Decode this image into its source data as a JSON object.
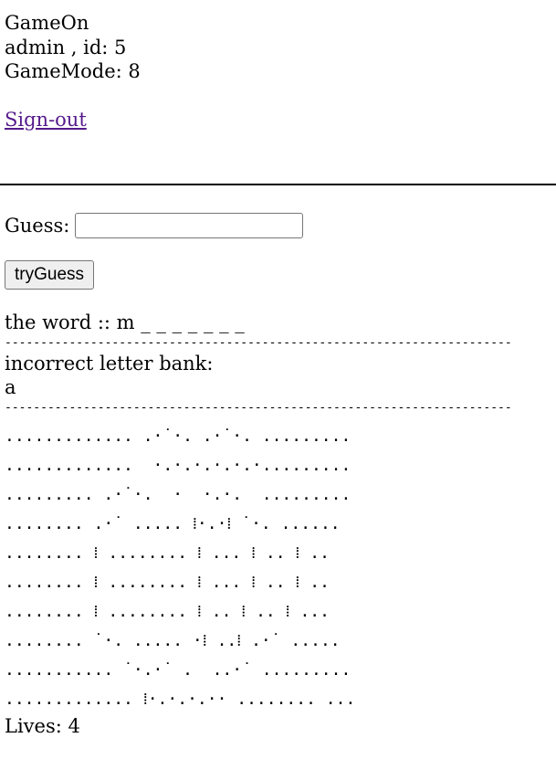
{
  "header": {
    "app_title": "GameOn",
    "user_line": "admin , id: 5",
    "game_mode": "GameMode: 8",
    "signout_link": "Sign-out"
  },
  "guess": {
    "label": "Guess:",
    "value": "",
    "placeholder": ""
  },
  "button": {
    "try_label": "tryGuess"
  },
  "word": {
    "text": "the word :: m _ _ _ _ _ _ _"
  },
  "separator": "-----------------------------------------------------------------------",
  "bank": {
    "label": "incorrect letter bank:",
    "letters": "a"
  },
  "art_lines": [
    "............. .·˙·. .·˙·. .........",
    ".............  ·.·.·.·.·.·.........",
    "......... .·˙·.  ·  ·.·.  .........",
    "........ .·˙ ..... ⁞·.·⁞ ˙·. ......",
    "........ ⁞ ........ ⁞ ... ⁞ .. ⁞ ..",
    "........ ⁞ ........ ⁞ ... ⁞ .. ⁞ ..",
    "........ ⁞ ........ ⁞ .. ⁞ .. ⁞ ...",
    "........ ˙·. ..... ·⁞ ..⁞ .·˙ .....",
    "........... ˙·.·˙ .  ..·˙ .........",
    "............. ⁞·.·.·.·· ........ ..."
  ],
  "lives": "Lives: 4"
}
